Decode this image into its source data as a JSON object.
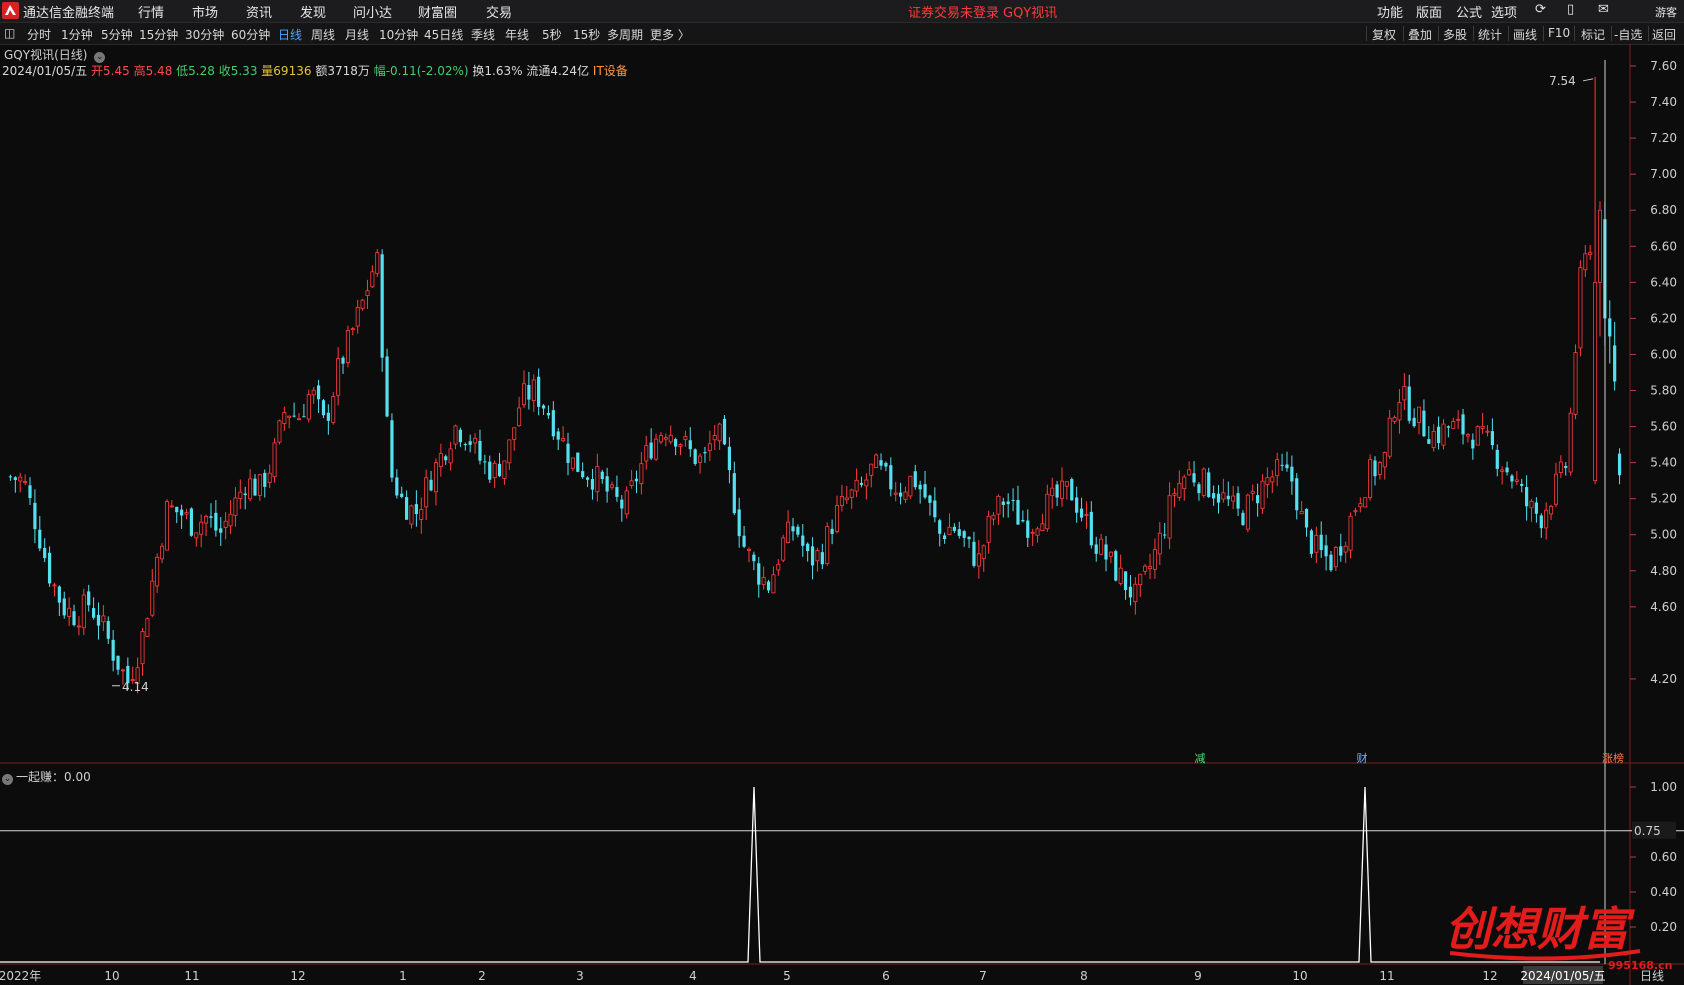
{
  "menu": {
    "app_title": "通达信金融终端",
    "items": [
      "行情",
      "市场",
      "资讯",
      "发现",
      "问小达",
      "财富圈",
      "交易"
    ],
    "status": "证券交易未登录",
    "stock": "GQY视讯",
    "right_items": [
      "功能",
      "版面",
      "公式",
      "选项"
    ],
    "guest": "游客"
  },
  "periods": {
    "tabs": [
      "分时",
      "1分钟",
      "5分钟",
      "15分钟",
      "30分钟",
      "60分钟",
      "日线",
      "周线",
      "月线",
      "10分钟",
      "45日线",
      "季线",
      "年线",
      "5秒",
      "15秒",
      "多周期",
      "更多 〉"
    ],
    "active": "日线",
    "right_buttons": [
      "复权",
      "叠加",
      "多股",
      "统计",
      "画线",
      "F10",
      "标记",
      "-自选",
      "返回"
    ]
  },
  "chart": {
    "title": "GQY视讯(日线)",
    "date": "2024/01/05/五",
    "open": "开5.45",
    "high": "高5.48",
    "low": "低5.28",
    "close": "收5.33",
    "volume": "量69136",
    "amount": "额3718万",
    "change": "幅-0.11(-2.02%)",
    "turnover": "换1.63%",
    "float": "流通4.24亿",
    "sector": "IT设备",
    "max_label": "7.54",
    "min_label": "4.14",
    "markers": [
      "减",
      "财",
      "涨榜"
    ],
    "colors": {
      "up": "#ff3b3b",
      "down": "#54e0ef",
      "grid": "#3a1a1a"
    }
  },
  "sub_chart": {
    "title": "一起赚：0.00",
    "level": "0.75",
    "y_ticks": [
      "1.00",
      "0.60",
      "0.40",
      "0.20"
    ]
  },
  "x_axis": {
    "labels": [
      "2022年",
      "10",
      "11",
      "12",
      "1",
      "2",
      "3",
      "4",
      "5",
      "6",
      "7",
      "8",
      "9",
      "10",
      "11",
      "12"
    ],
    "current_date": "2024/01/05/五",
    "period": "日线"
  },
  "watermark": {
    "text": "创想财富",
    "url": "995168.cn"
  },
  "chart_data": {
    "type": "candlestick",
    "ylim": [
      4.1,
      7.7
    ],
    "y_ticks": [
      7.6,
      7.4,
      7.2,
      7.0,
      6.8,
      6.6,
      6.4,
      6.2,
      6.0,
      5.8,
      5.6,
      5.4,
      5.2,
      5.0,
      4.8,
      4.6,
      4.2
    ],
    "close_path": [
      5.32,
      5.3,
      5.05,
      4.78,
      4.6,
      4.55,
      4.62,
      4.5,
      4.32,
      4.18,
      4.4,
      4.8,
      5.15,
      5.12,
      5.05,
      5.1,
      5.0,
      5.15,
      5.3,
      5.25,
      5.4,
      5.7,
      5.65,
      5.8,
      5.6,
      5.9,
      6.1,
      6.3,
      6.55,
      5.35,
      5.18,
      5.12,
      5.3,
      5.45,
      5.6,
      5.55,
      5.4,
      5.35,
      5.45,
      5.75,
      5.8,
      5.7,
      5.55,
      5.4,
      5.35,
      5.3,
      5.2,
      5.15,
      5.35,
      5.5,
      5.6,
      5.55,
      5.45,
      5.4,
      5.6,
      5.3,
      4.95,
      4.8,
      4.72,
      4.95,
      5.05,
      4.85,
      4.9,
      5.1,
      5.2,
      5.25,
      5.38,
      5.3,
      5.25,
      5.32,
      5.2,
      5.0,
      5.05,
      4.95,
      4.85,
      5.1,
      5.2,
      5.1,
      5.05,
      5.15,
      5.2,
      5.25,
      5.1,
      4.95,
      4.85,
      4.75,
      4.65,
      4.8,
      5.0,
      5.25,
      5.35,
      5.3,
      5.25,
      5.18,
      5.1,
      5.2,
      5.3,
      5.35,
      5.3,
      5.0,
      4.9,
      4.85,
      5.0,
      5.2,
      5.35,
      5.4,
      5.8,
      5.7,
      5.6,
      5.55,
      5.6,
      5.58,
      5.55,
      5.5,
      5.4,
      5.3,
      5.15,
      5.1,
      5.25,
      5.4,
      6.4,
      6.7,
      5.95,
      5.33
    ],
    "peak_value": 7.54,
    "trough_value": 4.14,
    "signal_positions": [
      "2023-05 early",
      "2023-10 late"
    ],
    "signal_value": 1.0
  }
}
